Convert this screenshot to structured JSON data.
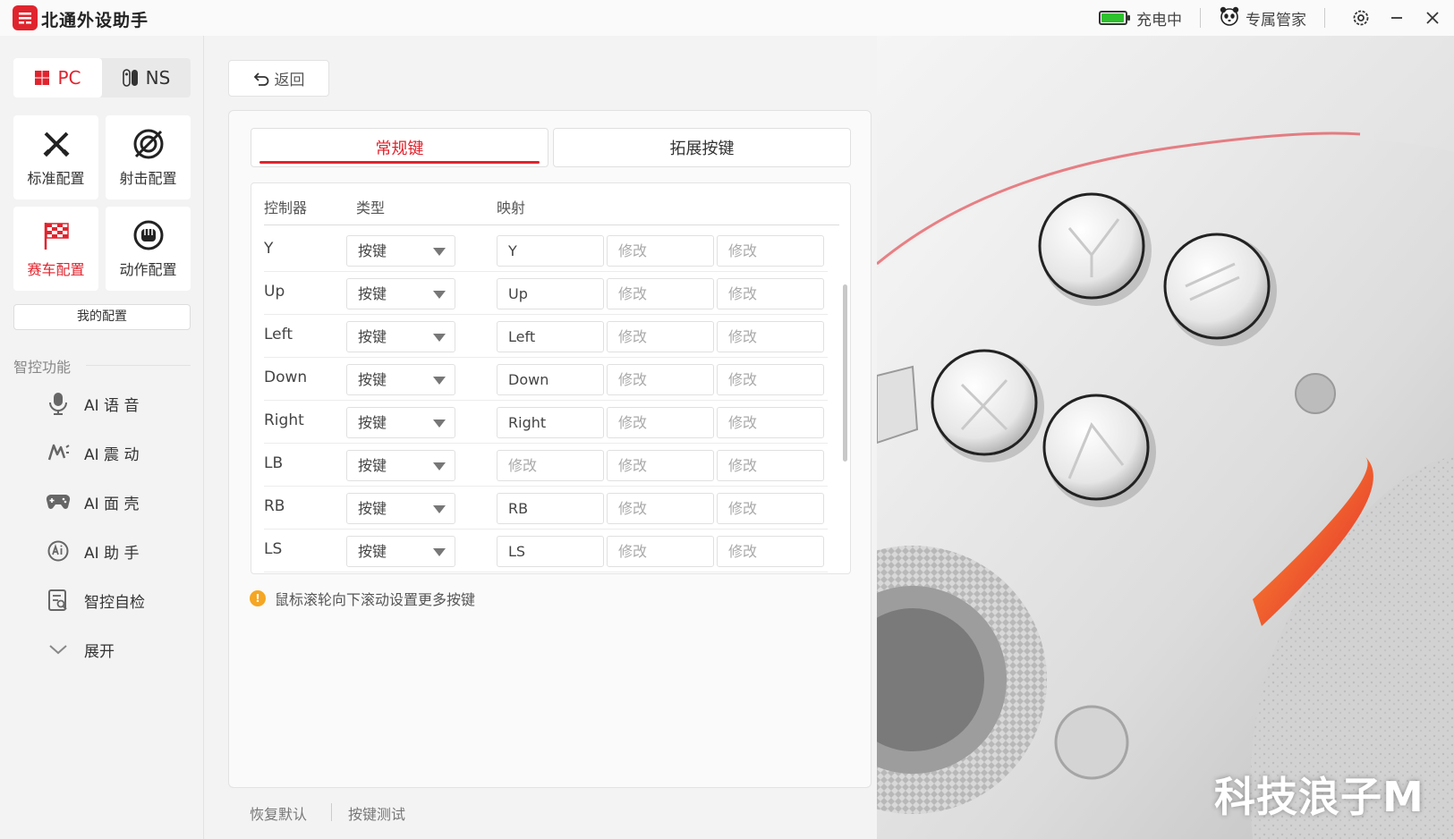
{
  "app": {
    "title": "北通外设助手"
  },
  "titlebar": {
    "battery_fill": 0.95,
    "battery_color": "#2dc12d",
    "charging_text": "充电中",
    "butler_text": "专属管家",
    "settings_icon": "gear-icon",
    "minimize_icon": "minimize-icon",
    "close_icon": "close-icon"
  },
  "sidebar": {
    "platforms": [
      {
        "label": "PC",
        "icon": "windows-icon",
        "active": true
      },
      {
        "label": "NS",
        "icon": "switch-icon",
        "active": false
      }
    ],
    "configs": [
      {
        "label": "标准配置",
        "icon": "crossed-swords-icon",
        "active": false
      },
      {
        "label": "射击配置",
        "icon": "target-icon",
        "active": false
      },
      {
        "label": "赛车配置",
        "icon": "checkered-flag-icon",
        "active": true
      },
      {
        "label": "动作配置",
        "icon": "fist-icon",
        "active": false
      }
    ],
    "my_config_label": "我的配置",
    "smart_title": "智控功能",
    "smart_items": [
      {
        "label": "AI 语 音",
        "icon": "microphone-icon"
      },
      {
        "label": "AI 震 动",
        "icon": "vibration-icon"
      },
      {
        "label": "AI 面 壳",
        "icon": "gamepad-icon"
      },
      {
        "label": "AI 助 手",
        "icon": "ai-assistant-icon"
      },
      {
        "label": "智控自检",
        "icon": "self-check-icon"
      },
      {
        "label": "展开",
        "icon": "chevron-down-icon"
      }
    ]
  },
  "main": {
    "back_label": "返回",
    "tabs": [
      {
        "label": "常规键",
        "active": true
      },
      {
        "label": "拓展按键",
        "active": false
      }
    ],
    "table": {
      "headers": [
        "控制器",
        "类型",
        "映射"
      ],
      "rows": [
        {
          "control": "Y",
          "type": "按键",
          "map": [
            "Y",
            "修改",
            "修改"
          ]
        },
        {
          "control": "Up",
          "type": "按键",
          "map": [
            "Up",
            "修改",
            "修改"
          ]
        },
        {
          "control": "Left",
          "type": "按键",
          "map": [
            "Left",
            "修改",
            "修改"
          ]
        },
        {
          "control": "Down",
          "type": "按键",
          "map": [
            "Down",
            "修改",
            "修改"
          ]
        },
        {
          "control": "Right",
          "type": "按键",
          "map": [
            "Right",
            "修改",
            "修改"
          ]
        },
        {
          "control": "LB",
          "type": "按键",
          "map": [
            "修改",
            "修改",
            "修改"
          ]
        },
        {
          "control": "RB",
          "type": "按键",
          "map": [
            "RB",
            "修改",
            "修改"
          ]
        },
        {
          "control": "LS",
          "type": "按键",
          "map": [
            "LS",
            "修改",
            "修改"
          ]
        }
      ]
    },
    "hint": "鼠标滚轮向下滚动设置更多按键",
    "restore_label": "恢复默认",
    "test_label": "按键测试"
  },
  "watermark": "科技浪子M",
  "colors": {
    "accent": "#e0242e",
    "warning": "#f5a623"
  }
}
